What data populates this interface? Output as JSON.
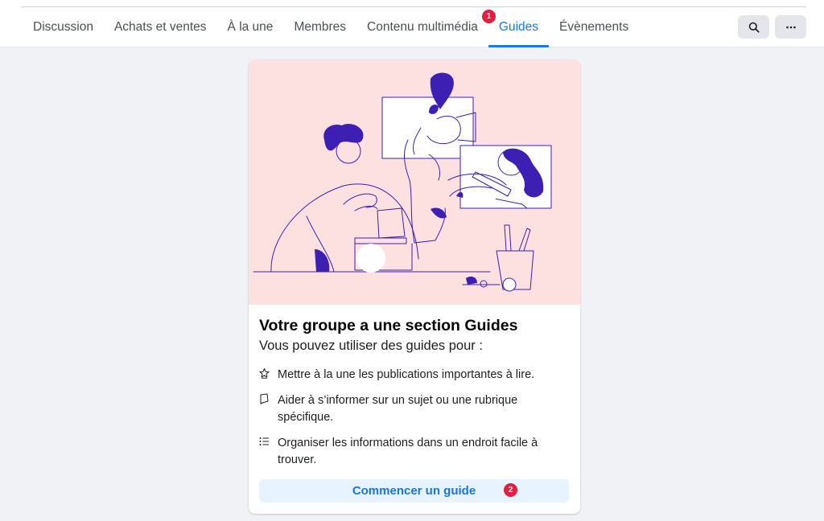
{
  "nav": {
    "tabs": [
      {
        "label": "Discussion"
      },
      {
        "label": "Achats et ventes"
      },
      {
        "label": "À la une"
      },
      {
        "label": "Membres"
      },
      {
        "label": "Contenu multimédia"
      },
      {
        "label": "Guides",
        "active": true,
        "badge": "1"
      },
      {
        "label": "Évènements"
      }
    ],
    "search_icon": "search-icon",
    "more_icon": "more-horizontal-icon"
  },
  "card": {
    "title": "Votre groupe a une section Guides",
    "subtitle": "Vous pouvez utiliser des guides pour :",
    "features": [
      {
        "icon": "star-icon",
        "text": "Mettre à la une les publications importantes à lire."
      },
      {
        "icon": "bookmark-icon",
        "text": "Aider à s’informer sur un sujet ou une rubrique spécifique."
      },
      {
        "icon": "list-icon",
        "text": "Organiser les informations dans un endroit facile à trouver."
      }
    ],
    "button_label": "Commencer un guide",
    "button_badge": "2"
  },
  "colors": {
    "accent": "#1877f2",
    "badge": "#e41e3f",
    "illustration_bg": "#fde1e1",
    "illustration_purple": "#3d1fb3",
    "button_bg": "#e7f3ff"
  }
}
